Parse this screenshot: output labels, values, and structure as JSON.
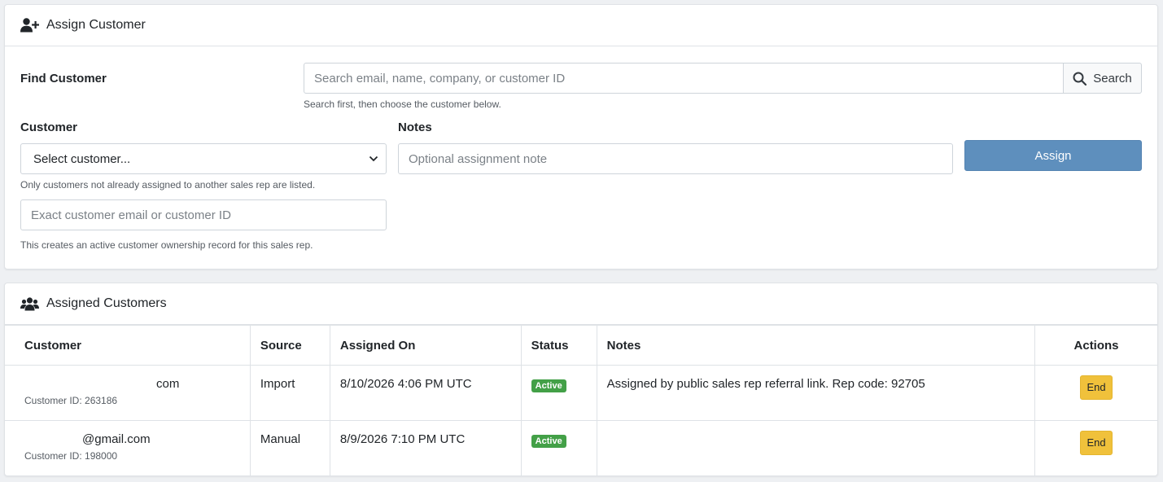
{
  "assign_card": {
    "title": "Assign Customer",
    "icon": "user-plus-icon",
    "find_label": "Find Customer",
    "search_placeholder": "Search email, name, company, or customer ID",
    "search_button": "Search",
    "search_help": "Search first, then choose the customer below.",
    "customer_label": "Customer",
    "customer_select_value": "Select customer...",
    "customer_help": "Only customers not already assigned to another sales rep are listed.",
    "exact_placeholder": "Exact customer email or customer ID",
    "exact_help": "This creates an active customer ownership record for this sales rep.",
    "notes_label": "Notes",
    "notes_placeholder": "Optional assignment note",
    "assign_button": "Assign"
  },
  "list_card": {
    "title": "Assigned Customers",
    "icon": "users-icon",
    "columns": {
      "customer": "Customer",
      "source": "Source",
      "assigned_on": "Assigned On",
      "status": "Status",
      "notes": "Notes",
      "actions": "Actions"
    },
    "rows": [
      {
        "customer": "com",
        "customer_id": "Customer ID: 263186",
        "source": "Import",
        "assigned_on": "8/10/2026 4:06 PM UTC",
        "status": "Active",
        "notes": "Assigned by public sales rep referral link. Rep code: 92705",
        "action": "End"
      },
      {
        "customer": "@gmail.com",
        "customer_id": "Customer ID: 198000",
        "source": "Manual",
        "assigned_on": "8/9/2026 7:10 PM UTC",
        "status": "Active",
        "notes": "",
        "action": "End"
      }
    ]
  },
  "colors": {
    "primary_button": "#5e8fbd",
    "status_active": "#43a047",
    "end_button": "#f0c13b"
  }
}
